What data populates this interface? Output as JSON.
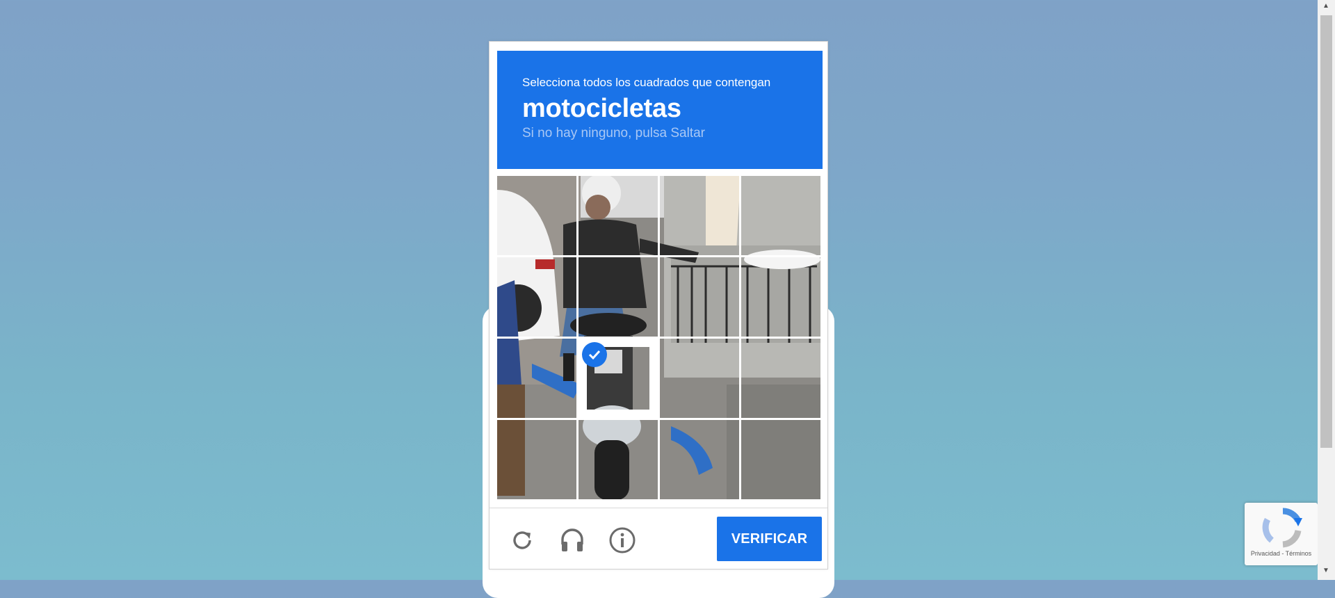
{
  "challenge": {
    "instruction": "Selecciona todos los cuadrados que contengan",
    "keyword": "motocicletas",
    "subtext": "Si no hay ninguno, pulsa Saltar"
  },
  "tiles": [
    {
      "selected": false
    },
    {
      "selected": false
    },
    {
      "selected": false
    },
    {
      "selected": false
    },
    {
      "selected": false
    },
    {
      "selected": false
    },
    {
      "selected": false
    },
    {
      "selected": false
    },
    {
      "selected": false
    },
    {
      "selected": true
    },
    {
      "selected": false
    },
    {
      "selected": false
    },
    {
      "selected": false
    },
    {
      "selected": false
    },
    {
      "selected": false
    },
    {
      "selected": false
    }
  ],
  "footer": {
    "reload_icon": "reload-icon",
    "audio_icon": "headphones-icon",
    "info_icon": "info-icon",
    "verify_label": "VERIFICAR"
  },
  "recaptcha_badge": {
    "links": "Privacidad - Términos"
  },
  "colors": {
    "accent": "#1a73e8",
    "subtext": "#a9c8f5"
  }
}
